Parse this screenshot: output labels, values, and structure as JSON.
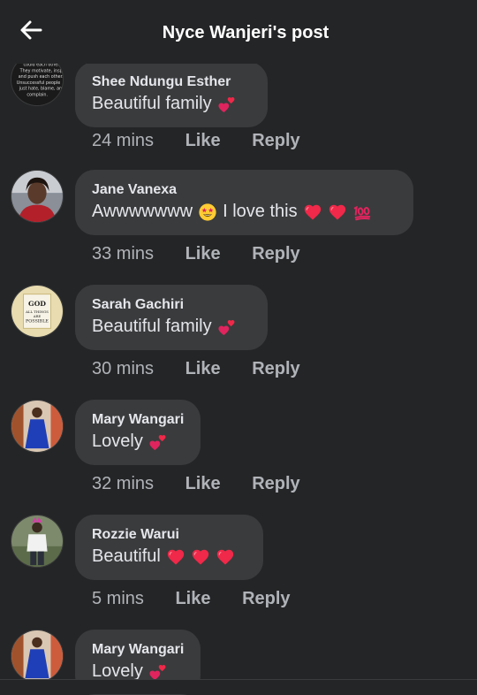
{
  "header": {
    "title": "Nyce Wanjeri's post",
    "back_icon": "arrow-left-icon"
  },
  "comments": [
    {
      "author": "Shee Ndungu Esther",
      "text": "Beautiful family",
      "emojis": [
        "two-hearts-icon"
      ],
      "time": "24 mins",
      "like_label": "Like",
      "reply_label": "Reply"
    },
    {
      "author": "Jane Vanexa",
      "text": "Awwwwwww",
      "text_after": "I love this",
      "emojis_mid": [
        "star-struck-icon"
      ],
      "emojis": [
        "red-heart-icon",
        "red-heart-icon",
        "hundred-points-icon"
      ],
      "time": "33 mins",
      "like_label": "Like",
      "reply_label": "Reply"
    },
    {
      "author": "Sarah Gachiri",
      "text": "Beautiful family",
      "emojis": [
        "two-hearts-icon"
      ],
      "time": "30 mins",
      "like_label": "Like",
      "reply_label": "Reply"
    },
    {
      "author": "Mary Wangari",
      "text": "Lovely",
      "emojis": [
        "two-hearts-icon"
      ],
      "time": "32 mins",
      "like_label": "Like",
      "reply_label": "Reply"
    },
    {
      "author": "Rozzie Warui",
      "text": "Beautiful",
      "emojis": [
        "red-heart-icon",
        "red-heart-icon",
        "red-heart-icon"
      ],
      "time": "5 mins",
      "like_label": "Like",
      "reply_label": "Reply"
    },
    {
      "author": "Mary Wangari",
      "text": "Lovely",
      "emojis": [
        "two-hearts-icon"
      ],
      "time": "",
      "like_label": "",
      "reply_label": ""
    }
  ],
  "avatar_image_text": "could each other up. They motivate, inspire and push each other. Unsuccessful people just hate, blame, and complain.",
  "colors": {
    "background": "#242526",
    "bubble": "#3a3b3c",
    "text": "#e4e6eb",
    "secondary_text": "#b0b3b8",
    "heart": "#f02849"
  }
}
